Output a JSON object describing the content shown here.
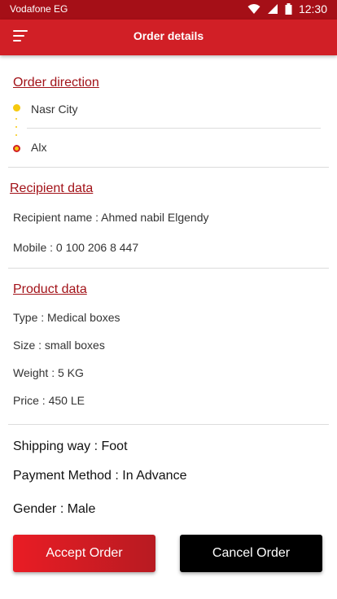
{
  "status_bar": {
    "carrier": "Vodafone EG",
    "time": "12:30"
  },
  "header": {
    "title": "Order details"
  },
  "order_direction": {
    "title": "Order direction",
    "from": "Nasr City",
    "to": "Alx"
  },
  "recipient": {
    "title": "Recipient data",
    "name_line": "Recipient name : Ahmed nabil Elgendy",
    "mobile_line": "Mobile : 0 100 206 8 447"
  },
  "product": {
    "title": "Product data",
    "type_line": "Type : Medical boxes",
    "size_line": "Size : small boxes",
    "weight_line": "Weight : 5 KG",
    "price_line": "Price : 450 LE"
  },
  "details": {
    "shipping_line": "Shipping way : Foot",
    "payment_line": "Payment Method : In Advance",
    "gender_line": "Gender : Male"
  },
  "actions": {
    "accept_label": "Accept Order",
    "cancel_label": "Cancel Order"
  },
  "colors": {
    "primary": "#d11f26",
    "status": "#a50f17",
    "accent_title": "#a21218",
    "marker": "#f6c90e"
  },
  "icons": [
    "wifi-icon",
    "signal-icon",
    "battery-icon",
    "menu-icon"
  ]
}
